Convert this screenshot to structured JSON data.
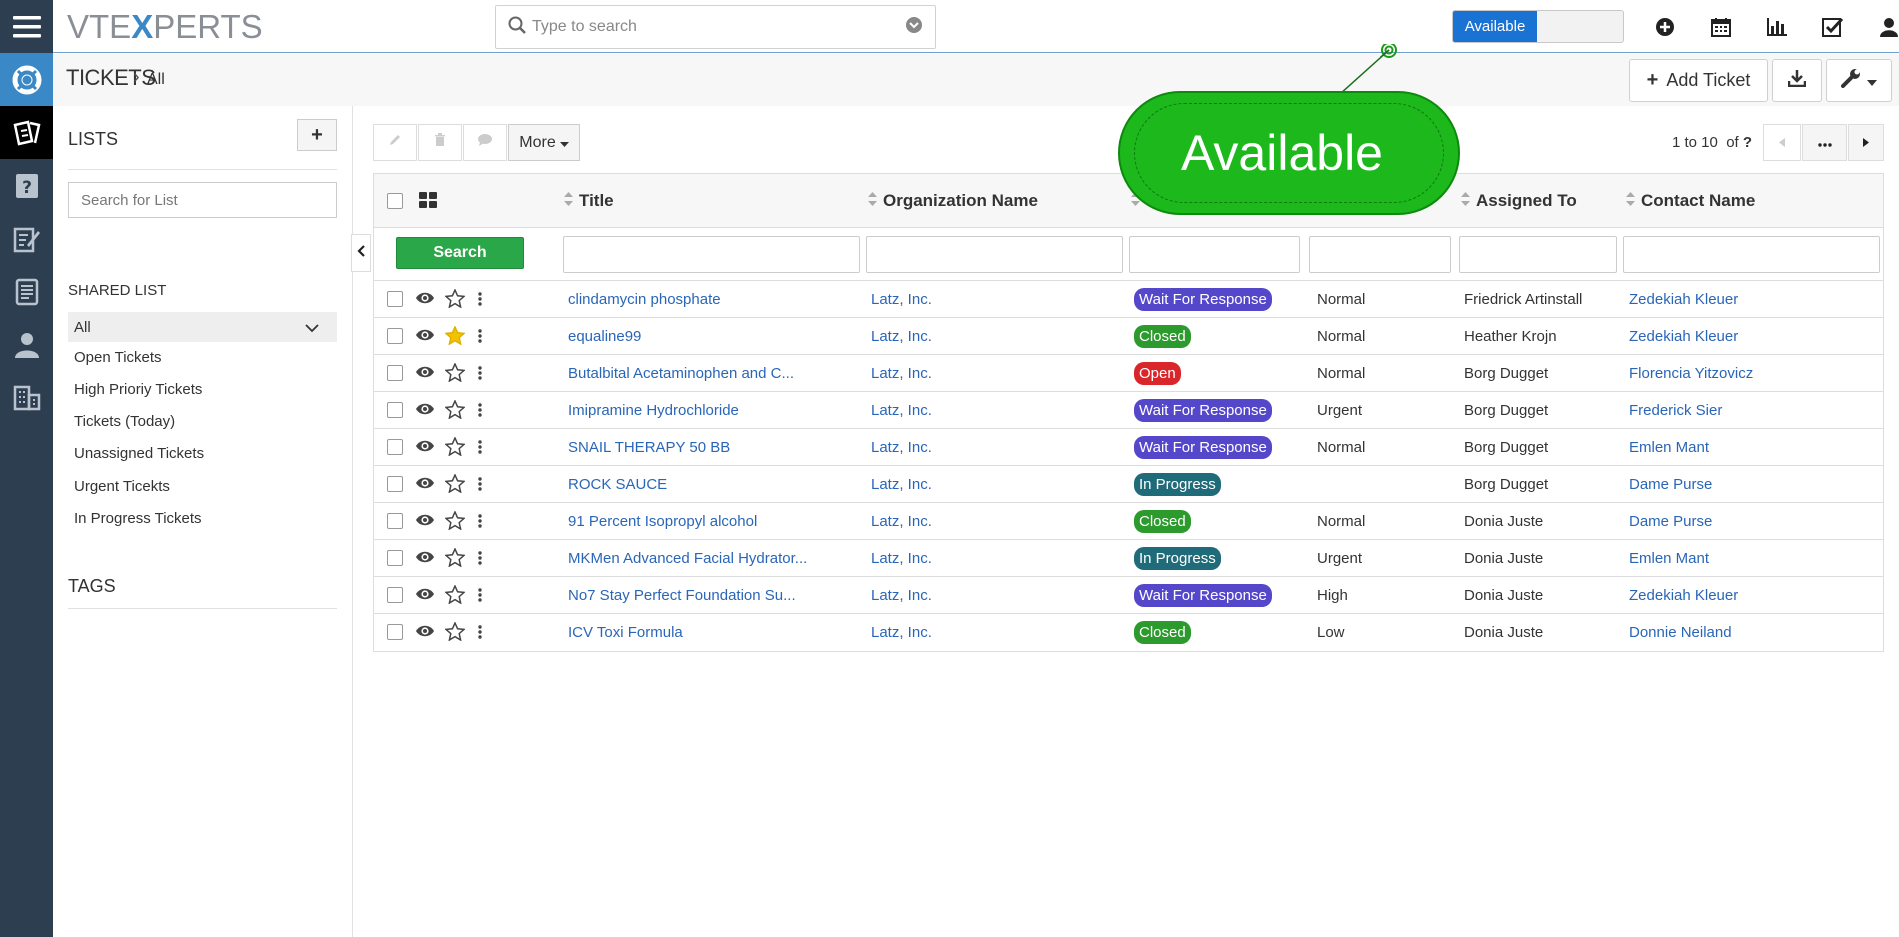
{
  "colors": {
    "rail_bg": "#2d3e50",
    "accent": "#3a88c6",
    "link": "#2a66b8",
    "search_btn": "#2aa748",
    "callout": "#1cb81c"
  },
  "topbar": {
    "logo_pre": "VTE",
    "logo_x": "X",
    "logo_post": "PERTS",
    "search_placeholder": "Type to search",
    "availability_label": "Available",
    "icons": [
      "plus-circle-icon",
      "calendar-icon",
      "reports-icon",
      "tasks-icon",
      "user-icon"
    ]
  },
  "rail": {
    "icons": [
      "menu-icon",
      "help-desk-icon",
      "tickets-icon",
      "faq-icon",
      "documents-icon",
      "invoice-icon",
      "contacts-icon",
      "organizations-icon"
    ]
  },
  "breadcrumb": {
    "module": "Tickets",
    "separator": "›",
    "view": "All"
  },
  "header_actions": {
    "add_ticket": "Add Ticket"
  },
  "lists": {
    "title": "LISTS",
    "add": "+",
    "search_placeholder": "Search for List",
    "shared_title": "SHARED LIST",
    "selected": "All",
    "items": [
      "Open Tickets",
      "High Prioriy Tickets",
      "Tickets (Today)",
      "Unassigned Tickets",
      "Urgent Ticekts",
      "In Progress Tickets"
    ],
    "tags_title": "TAGS"
  },
  "actions": {
    "more": "More"
  },
  "pager": {
    "range": "1 to 10",
    "of": "of",
    "total": "?"
  },
  "table": {
    "columns": [
      "Title",
      "Organization Name",
      "Assigned To",
      "Contact Name"
    ],
    "search_label": "Search",
    "rows": [
      {
        "title": "clindamycin phosphate",
        "org": "Latz, Inc.",
        "status": "Wait For Response",
        "priority": "Normal",
        "assigned": "Friedrick Artinstall",
        "contact": "Zedekiah Kleuer",
        "starred": false
      },
      {
        "title": "equaline99",
        "org": "Latz, Inc.",
        "status": "Closed",
        "priority": "Normal",
        "assigned": "Heather Krojn",
        "contact": "Zedekiah Kleuer",
        "starred": true
      },
      {
        "title": "Butalbital Acetaminophen and C...",
        "org": "Latz, Inc.",
        "status": "Open",
        "priority": "Normal",
        "assigned": "Borg Dugget",
        "contact": "Florencia Yitzovicz",
        "starred": false
      },
      {
        "title": "Imipramine Hydrochloride",
        "org": "Latz, Inc.",
        "status": "Wait For Response",
        "priority": "Urgent",
        "assigned": "Borg Dugget",
        "contact": "Frederick Sier",
        "starred": false
      },
      {
        "title": "SNAIL THERAPY 50 BB",
        "org": "Latz, Inc.",
        "status": "Wait For Response",
        "priority": "Normal",
        "assigned": "Borg Dugget",
        "contact": "Emlen Mant",
        "starred": false
      },
      {
        "title": "ROCK SAUCE",
        "org": "Latz, Inc.",
        "status": "In Progress",
        "priority": "",
        "assigned": "Borg Dugget",
        "contact": "Dame Purse",
        "starred": false
      },
      {
        "title": "91 Percent Isopropyl alcohol",
        "org": "Latz, Inc.",
        "status": "Closed",
        "priority": "Normal",
        "assigned": "Donia Juste",
        "contact": "Dame Purse",
        "starred": false
      },
      {
        "title": "MKMen Advanced Facial Hydrator...",
        "org": "Latz, Inc.",
        "status": "In Progress",
        "priority": "Urgent",
        "assigned": "Donia Juste",
        "contact": "Emlen Mant",
        "starred": false
      },
      {
        "title": "No7 Stay Perfect Foundation Su...",
        "org": "Latz, Inc.",
        "status": "Wait For Response",
        "priority": "High",
        "assigned": "Donia Juste",
        "contact": "Zedekiah Kleuer",
        "starred": false
      },
      {
        "title": "ICV Toxi Formula",
        "org": "Latz, Inc.",
        "status": "Closed",
        "priority": "Low",
        "assigned": "Donia Juste",
        "contact": "Donnie Neiland",
        "starred": false
      }
    ]
  },
  "status_colors": {
    "Wait For Response": "#5547c9",
    "Closed": "#2c9a2c",
    "Open": "#d9262a",
    "In Progress": "#1f6b7a"
  },
  "callout": {
    "text": "Available"
  }
}
